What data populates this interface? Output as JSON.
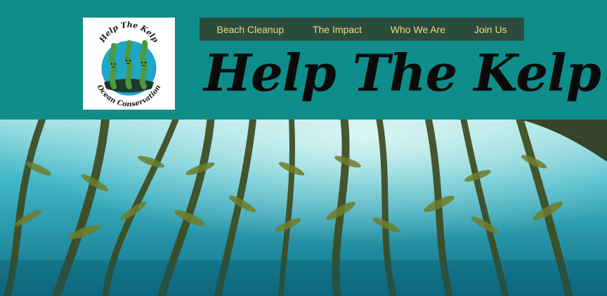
{
  "logo": {
    "top_text": "Help The Kelp",
    "bottom_text": "Ocean Conservation"
  },
  "nav": {
    "items": [
      {
        "label": "Beach Cleanup"
      },
      {
        "label": "The Impact"
      },
      {
        "label": "Who We Are"
      },
      {
        "label": "Join Us"
      }
    ]
  },
  "header": {
    "title": "Help The Kelp"
  },
  "hero": {
    "image": "kelp-forest-underwater-photo"
  },
  "colors": {
    "header_bg": "#0f8d8b",
    "nav_bg": "#2b4c3b",
    "nav_text": "#f3d978",
    "title_text": "#0a0a0a"
  }
}
